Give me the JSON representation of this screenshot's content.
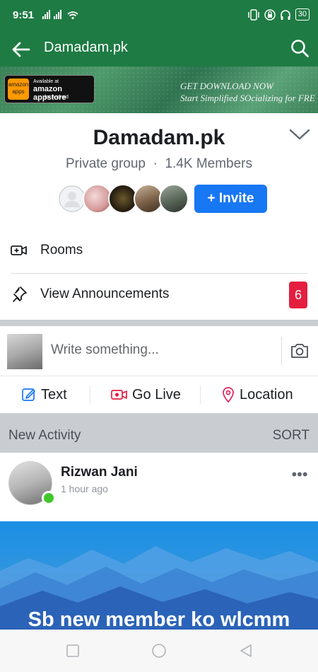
{
  "status_bar": {
    "time": "9:51",
    "battery": "30"
  },
  "app_bar": {
    "title": "Damadam.pk"
  },
  "banner": {
    "badge_small": "Available at",
    "badge_big": "amazon appstore",
    "badge_sub": "for Android",
    "badge_icon_text": "amazon apps",
    "line1": "GET DOWNLOAD NOW",
    "line2": "Start Simplified SOcializing for FRE"
  },
  "group": {
    "name": "Damadam.pk",
    "privacy": "Private group",
    "separator": "·",
    "members": "1.4K Members",
    "invite_label": "+ Invite"
  },
  "menu": {
    "rooms_label": "Rooms",
    "announcements_label": "View Announcements",
    "announcements_count": "6"
  },
  "composer": {
    "placeholder": "Write something...",
    "text_label": "Text",
    "live_label": "Go Live",
    "location_label": "Location"
  },
  "activity": {
    "label": "New Activity",
    "sort_label": "SORT"
  },
  "post": {
    "author": "Rizwan Jani",
    "time": "1 hour ago",
    "more": "•••",
    "caption": "Sb new member ko wlcmm"
  },
  "colors": {
    "header_green": "#1e7b43",
    "invite_blue": "#1877f2",
    "badge_red": "#e41e3f",
    "online_green": "#42c72a"
  }
}
